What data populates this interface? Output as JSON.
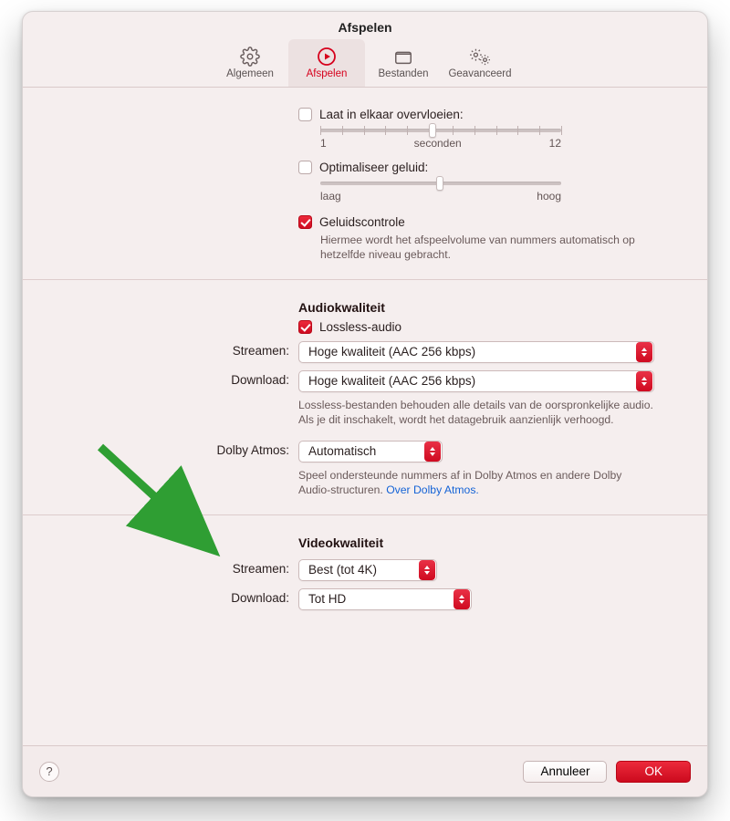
{
  "window": {
    "title": "Afspelen"
  },
  "tabs": {
    "general": "Algemeen",
    "playback": "Afspelen",
    "files": "Bestanden",
    "advanced": "Geavanceerd"
  },
  "sec1": {
    "crossfade": "Laat in elkaar overvloeien:",
    "sec_min": "1",
    "sec_lbl": "seconden",
    "sec_max": "12",
    "enhancer": "Optimaliseer geluid:",
    "low": "laag",
    "high": "hoog",
    "soundcheck": "Geluidscontrole",
    "soundcheck_desc": "Hiermee wordt het afspeelvolume van nummers automatisch op hetzelfde niveau gebracht."
  },
  "audio": {
    "heading": "Audiokwaliteit",
    "lossless": "Lossless-audio",
    "stream_lbl": "Streamen:",
    "stream_val": "Hoge kwaliteit (AAC 256 kbps)",
    "dl_lbl": "Download:",
    "dl_val": "Hoge kwaliteit (AAC 256 kbps)",
    "lossless_desc": "Lossless-bestanden behouden alle details van de oorspronkelijke audio. Als je dit inschakelt, wordt het datagebruik aanzienlijk verhoogd.",
    "atmos_lbl": "Dolby Atmos:",
    "atmos_val": "Automatisch",
    "atmos_desc1": "Speel ondersteunde nummers af in Dolby Atmos en andere Dolby Audio-structuren. ",
    "atmos_link": "Over Dolby Atmos."
  },
  "video": {
    "heading": "Videokwaliteit",
    "stream_lbl": "Streamen:",
    "stream_val": "Best (tot 4K)",
    "dl_lbl": "Download:",
    "dl_val": "Tot HD"
  },
  "footer": {
    "help": "?",
    "cancel": "Annuleer",
    "ok": "OK"
  }
}
